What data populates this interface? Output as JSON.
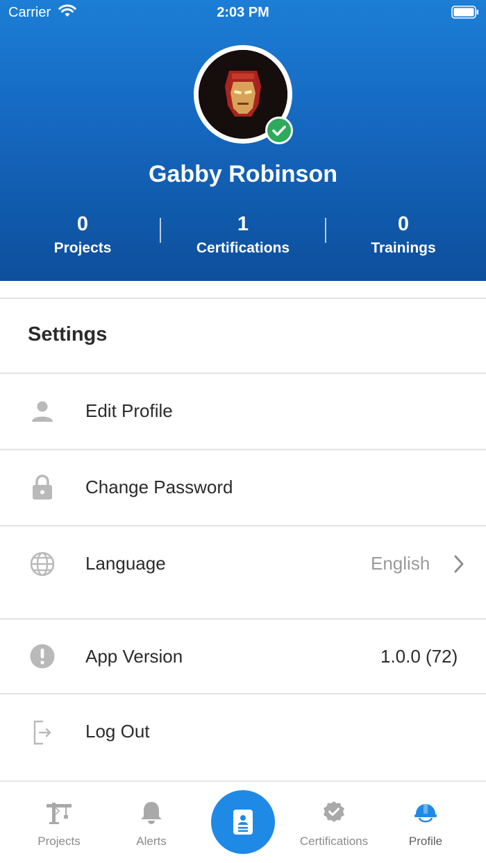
{
  "status_bar": {
    "carrier": "Carrier",
    "time": "2:03 PM"
  },
  "profile": {
    "name": "Gabby Robinson",
    "stats": [
      {
        "value": "0",
        "label": "Projects"
      },
      {
        "value": "1",
        "label": "Certifications"
      },
      {
        "value": "0",
        "label": "Trainings"
      }
    ]
  },
  "settings": {
    "title": "Settings",
    "items": [
      {
        "label": "Edit Profile",
        "icon": "person-icon"
      },
      {
        "label": "Change Password",
        "icon": "lock-icon"
      },
      {
        "label": "Language",
        "value": "English",
        "icon": "globe-icon"
      },
      {
        "label": "App Version",
        "value": "1.0.0 (72)",
        "icon": "info-icon"
      },
      {
        "label": "Log Out",
        "icon": "logout-icon"
      }
    ]
  },
  "tabbar": {
    "tabs": [
      {
        "label": "Projects",
        "icon": "crane-icon"
      },
      {
        "label": "Alerts",
        "icon": "bell-icon"
      },
      {
        "label": "",
        "icon": "badge-card-icon"
      },
      {
        "label": "Certifications",
        "icon": "certified-seal-icon"
      },
      {
        "label": "Profile",
        "icon": "hardhat-icon"
      }
    ],
    "active_color": "#1f8ae6",
    "inactive_color": "#8a8a8a"
  },
  "colors": {
    "header_top": "#1c7ed6",
    "header_bottom": "#0d4f9c",
    "verified": "#2eaa5c",
    "value_muted": "#9a9a9a"
  }
}
